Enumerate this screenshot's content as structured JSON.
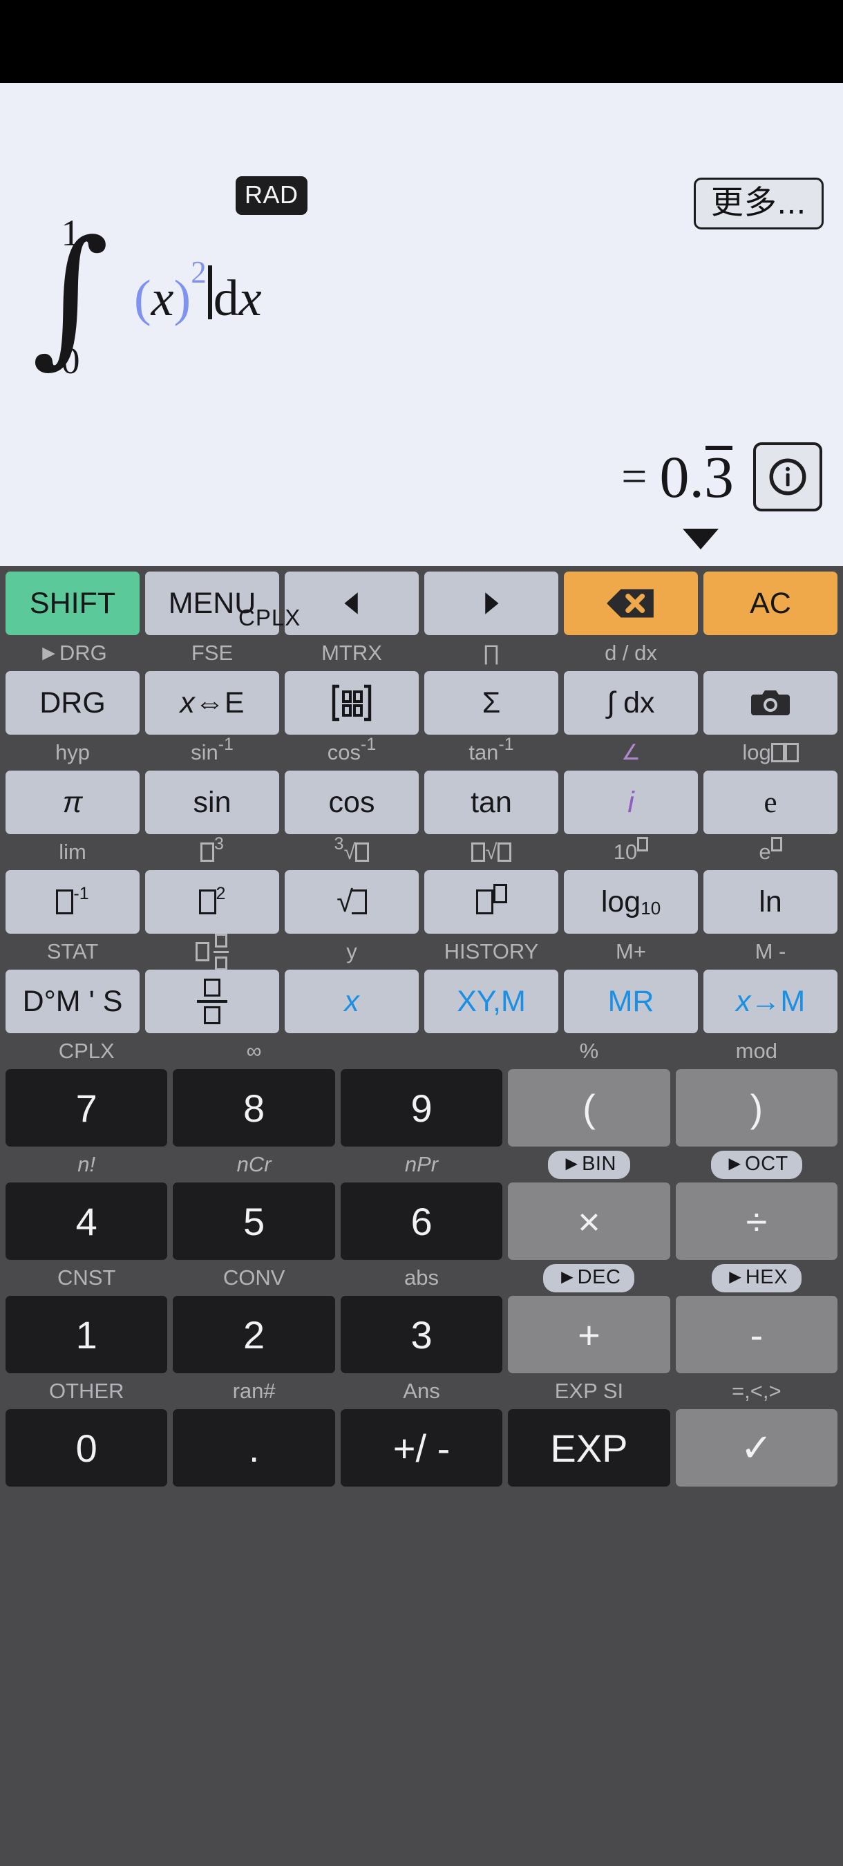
{
  "display": {
    "angle_mode_badge": "RAD",
    "more_button": "更多...",
    "expression": {
      "upper_limit": "1",
      "lower_limit": "0",
      "integrand_open_paren": "(",
      "integrand_var": "x",
      "integrand_close_paren": ")",
      "integrand_exponent": "2",
      "differential": "dx"
    },
    "equals_sign": "=",
    "result_integer": "0.",
    "result_repeating_digit": "3",
    "indicator": "CPLX",
    "info_icon": "info-circle-icon",
    "dropdown_icon": "triangle-down-icon"
  },
  "keypad": {
    "rows": [
      {
        "shift_labels": [
          "►DRG",
          "FSE",
          "MTRX",
          "∏",
          "d / dx",
          ""
        ],
        "keys": [
          {
            "label": "SHIFT",
            "style": "green"
          },
          {
            "label": "MENU",
            "style": "grey"
          },
          {
            "label": "◀",
            "style": "grey",
            "icon": "arrow-left-icon"
          },
          {
            "label": "▶",
            "style": "grey",
            "icon": "arrow-right-icon"
          },
          {
            "label": "",
            "style": "orange",
            "icon": "backspace-icon"
          },
          {
            "label": "AC",
            "style": "orange"
          }
        ]
      },
      {
        "shift_labels": [
          "hyp",
          "sin⁻¹",
          "cos⁻¹",
          "tan⁻¹",
          "∠",
          "log□ □"
        ],
        "keys": [
          {
            "label": "DRG",
            "style": "grey"
          },
          {
            "label": "x⇔E",
            "style": "grey"
          },
          {
            "label": "",
            "style": "grey",
            "icon": "matrix-icon"
          },
          {
            "label": "Σ",
            "style": "grey"
          },
          {
            "label": "∫ dx",
            "style": "grey"
          },
          {
            "label": "",
            "style": "grey",
            "icon": "camera-icon"
          }
        ]
      },
      {
        "shift_labels": [
          "lim",
          "□³",
          "³√□",
          "□√□",
          "10□",
          "e□"
        ],
        "keys": [
          {
            "label": "π",
            "style": "grey"
          },
          {
            "label": "sin",
            "style": "grey"
          },
          {
            "label": "cos",
            "style": "grey"
          },
          {
            "label": "tan",
            "style": "grey"
          },
          {
            "label": "i",
            "style": "grey"
          },
          {
            "label": "e",
            "style": "grey"
          }
        ]
      },
      {
        "shift_labels": [
          "STAT",
          "□ □/□",
          "y",
          "HISTORY",
          "M+",
          "M -"
        ],
        "keys": [
          {
            "label": "□⁻¹",
            "style": "grey"
          },
          {
            "label": "□²",
            "style": "grey"
          },
          {
            "label": "√□",
            "style": "grey"
          },
          {
            "label": "□□",
            "style": "grey"
          },
          {
            "label": "log10",
            "style": "grey"
          },
          {
            "label": "ln",
            "style": "grey"
          }
        ]
      },
      {
        "shift_labels": [
          "CPLX",
          "∞",
          "",
          "%",
          "mod"
        ],
        "keys": [
          {
            "label": "D°M ' S",
            "style": "grey"
          },
          {
            "label": "□/□",
            "style": "grey"
          },
          {
            "label": "x",
            "style": "grey"
          },
          {
            "label": "XY,M",
            "style": "grey"
          },
          {
            "label": "MR",
            "style": "grey"
          },
          {
            "label": "x→M",
            "style": "grey"
          }
        ]
      }
    ],
    "numpad": [
      {
        "shift_labels": [
          "CPLX",
          "∞",
          "",
          "%",
          "mod"
        ],
        "shift_pills": [
          false,
          false,
          false,
          false,
          false
        ],
        "keys": [
          {
            "label": "7",
            "style": "num"
          },
          {
            "label": "8",
            "style": "num"
          },
          {
            "label": "9",
            "style": "num"
          },
          {
            "label": "(",
            "style": "op"
          },
          {
            "label": ")",
            "style": "op"
          }
        ]
      },
      {
        "shift_labels": [
          "n!",
          "nCr",
          "nPr",
          "►BIN",
          "►OCT"
        ],
        "shift_pills": [
          false,
          false,
          false,
          true,
          true
        ],
        "keys": [
          {
            "label": "4",
            "style": "num"
          },
          {
            "label": "5",
            "style": "num"
          },
          {
            "label": "6",
            "style": "num"
          },
          {
            "label": "×",
            "style": "op"
          },
          {
            "label": "÷",
            "style": "op"
          }
        ]
      },
      {
        "shift_labels": [
          "CNST",
          "CONV",
          "abs",
          "►DEC",
          "►HEX"
        ],
        "shift_pills": [
          false,
          false,
          false,
          true,
          true
        ],
        "keys": [
          {
            "label": "1",
            "style": "num"
          },
          {
            "label": "2",
            "style": "num"
          },
          {
            "label": "3",
            "style": "num"
          },
          {
            "label": "+",
            "style": "op"
          },
          {
            "label": "-",
            "style": "op"
          }
        ]
      },
      {
        "shift_labels": [
          "OTHER",
          "ran#",
          "Ans",
          "EXP SI",
          "=,<,>"
        ],
        "shift_pills": [
          false,
          false,
          false,
          false,
          false
        ],
        "keys": [
          {
            "label": "0",
            "style": "num"
          },
          {
            "label": ".",
            "style": "num"
          },
          {
            "label": "+/ -",
            "style": "num"
          },
          {
            "label": "EXP",
            "style": "num"
          },
          {
            "label": "✓",
            "style": "enter"
          }
        ]
      }
    ]
  },
  "colors": {
    "display_bg": "#eceff7",
    "keypad_bg": "#4a4a4c",
    "key_grey": "#c3c7d2",
    "key_green": "#5cc99a",
    "key_orange": "#efa94a",
    "key_dark": "#1c1c1e",
    "key_op": "#868688",
    "accent_blue": "#7f92ef",
    "memory_blue": "#1a8fe3",
    "shift_label": "#b3b4b8",
    "purple": "#b08ad0"
  }
}
